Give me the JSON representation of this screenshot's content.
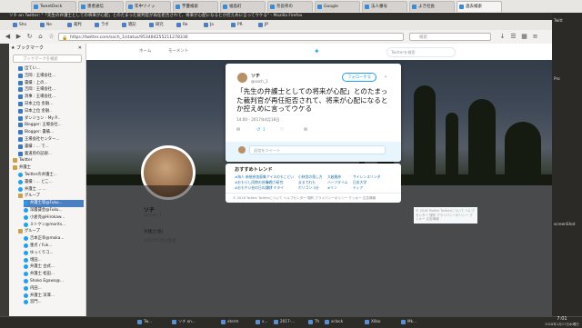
{
  "window": {
    "title": "ソチ on Twitter: \"「先生の弁護士としての将来が心配」とのたまった裁判官が再任拒否されて、将来が心配になるとか控えめに言ってウケる\" - Mozilla Firefox"
  },
  "tabs": [
    {
      "label": "TweetDeck"
    },
    {
      "label": "患者通信"
    },
    {
      "label": "年中ツイッ"
    },
    {
      "label": "芋蔓検索"
    },
    {
      "label": "福島町"
    },
    {
      "label": "奈良県の"
    },
    {
      "label": "Google"
    },
    {
      "label": "法人番号"
    },
    {
      "label": "よき社長"
    },
    {
      "label": "過去検索"
    }
  ],
  "bookmarks_bar": [
    {
      "label": "Sho"
    },
    {
      "label": "Ne"
    },
    {
      "label": "裁判"
    },
    {
      "label": "ラボ"
    },
    {
      "label": "雑記"
    },
    {
      "label": "研究"
    },
    {
      "label": "Re"
    },
    {
      "label": "Ja"
    },
    {
      "label": "PR"
    },
    {
      "label": "JP"
    }
  ],
  "urlbar": {
    "value": "https://twitter.com/soch_1/status/953484255211278336"
  },
  "searchbar": {
    "placeholder": "検索"
  },
  "sidebar": {
    "title": "ブックマーク",
    "search_placeholder": "ブックマークを検索",
    "items": [
      {
        "label": "出てい...",
        "type": "page",
        "indent": 1
      },
      {
        "label": "吉岡 : 王場会社...",
        "type": "page",
        "indent": 1
      },
      {
        "label": "書績 : 上の...",
        "type": "page",
        "indent": 1
      },
      {
        "label": "吉岡 : 王場会社...",
        "type": "page",
        "indent": 1
      },
      {
        "label": "消事 : 王場会社...",
        "type": "page",
        "indent": 1
      },
      {
        "label": "日本上位 金融...",
        "type": "page",
        "indent": 1
      },
      {
        "label": "日本上位 金融..",
        "type": "page",
        "indent": 1
      },
      {
        "label": "ダンジョン - My P...",
        "type": "page",
        "indent": 1
      },
      {
        "label": "Blogger: 王場会社...",
        "type": "page",
        "indent": 1
      },
      {
        "label": "Blogger: 書績...",
        "type": "page",
        "indent": 1
      },
      {
        "label": "王場会社センター...",
        "type": "page",
        "indent": 1
      },
      {
        "label": "書績 : ... で...",
        "type": "page",
        "indent": 1
      },
      {
        "label": "義道府の記録...",
        "type": "page",
        "indent": 1
      },
      {
        "label": "Twitter",
        "type": "folder",
        "indent": 0
      },
      {
        "label": "弁護士",
        "type": "folder",
        "indent": 0
      },
      {
        "label": "Twitterの弁護士...",
        "type": "tw",
        "indent": 1
      },
      {
        "label": "書績 : ... どこ...",
        "type": "tw",
        "indent": 1
      },
      {
        "label": "弁護士 ... ...",
        "type": "tw",
        "indent": 1
      },
      {
        "label": "グループ",
        "type": "folder",
        "indent": 1
      },
      {
        "label": "弁護士等@Fuku...",
        "type": "tw",
        "indent": 2,
        "selected": true
      },
      {
        "label": "深層賃金@Fuku...",
        "type": "tw",
        "indent": 2
      },
      {
        "label": "小倉亮@Hirokaw...",
        "type": "tw",
        "indent": 2
      },
      {
        "label": "ミトケン@morits...",
        "type": "tw",
        "indent": 2
      },
      {
        "label": "グループ",
        "type": "folder",
        "indent": 1
      },
      {
        "label": "吉本正幸@moka...",
        "type": "tw",
        "indent": 2
      },
      {
        "label": "重点 / Fuk...",
        "type": "tw",
        "indent": 2
      },
      {
        "label": "ゆっくりコ...",
        "type": "tw",
        "indent": 2
      },
      {
        "label": "増田...",
        "type": "tw",
        "indent": 2
      },
      {
        "label": "弁護士 古式...",
        "type": "tw",
        "indent": 2
      },
      {
        "label": "弁護士 松田...",
        "type": "tw",
        "indent": 2
      },
      {
        "label": "Shoko Egawa@...",
        "type": "tw",
        "indent": 2
      },
      {
        "label": "内田...",
        "type": "tw",
        "indent": 2
      },
      {
        "label": "弁護士 深澤...",
        "type": "tw",
        "indent": 2
      },
      {
        "label": "宮門...",
        "type": "tw",
        "indent": 2
      }
    ]
  },
  "twitter_nav": {
    "home": "ホーム",
    "moments": "モーメント",
    "search": "Twitterを検索"
  },
  "profile": {
    "name": "ソチ",
    "handle": "@soch_1",
    "bio": "弁護士(仮)",
    "joined": "2012年1月に登録"
  },
  "tweet": {
    "name": "ソチ",
    "handle": "@soch_1",
    "follow_label": "フォローする",
    "text": "「先生の弁護士としての将来が心配」とのたまった裁判官が再任拒否されて、将来が心配になるとか控えめに言ってウケる",
    "time": "14:00 - 2017年4月18日",
    "reply_count": "",
    "retweet_count": "1",
    "like_count": "",
    "reply_placeholder": "返信をツイート"
  },
  "trends": {
    "title": "おすすめトレンド",
    "rows": [
      [
        "#海人 新規参加募集",
        "アイスのもこどい",
        "小林貴の落し方",
        "大越雅彦",
        "サイレンスリンダ"
      ],
      [
        "#おもらし同期の芸術の",
        "#目力研究",
        "まるでれも",
        "ハーフタイム",
        "日本大学"
      ],
      [
        "#おもやい芸の日の設計",
        "ミナミタイ",
        "ポリゴン 3分",
        "#リン",
        "ティア"
      ]
    ]
  },
  "footer": {
    "text": "© 2018 Twitter  Twitterについて  ヘルプセンター  規約  プライバシーポリシー  クッキー  広告情報"
  },
  "rightbox": {
    "text": "© 2018 Twitter  Twitterについて  ヘルプセンター  規約  プライバシーポリシー  クッキー  広告情報"
  },
  "right_strip": [
    {
      "label": "Twitt"
    },
    {
      "label": "Pro"
    },
    {
      "label": "screenShot"
    }
  ],
  "taskbar": {
    "items": [
      {
        "label": "Tw..."
      },
      {
        "label": "ソチ on..."
      },
      {
        "label": "xterm"
      },
      {
        "label": "x..."
      },
      {
        "label": "2017-..."
      },
      {
        "label": "Th"
      },
      {
        "label": "xclock"
      },
      {
        "label": "Xlibo"
      },
      {
        "label": "Mk..."
      }
    ],
    "clock_time": "7:01",
    "clock_date": "2018年1月17日水曜日"
  },
  "colors": {
    "twitter_blue": "#1da1f2",
    "selection": "#4a7fc1"
  }
}
